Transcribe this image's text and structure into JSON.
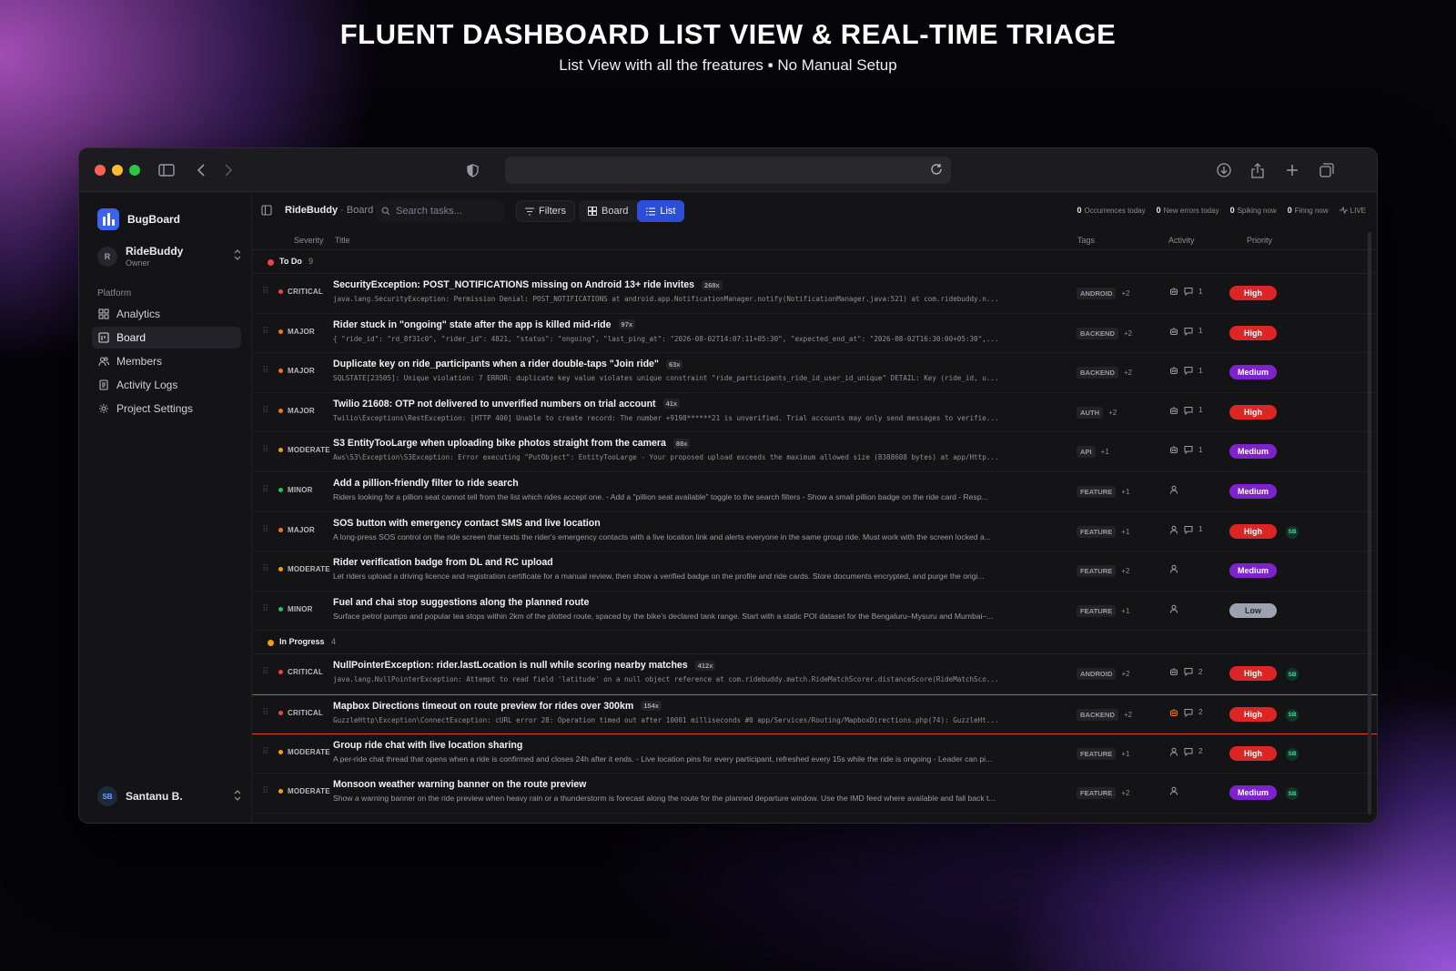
{
  "hero": {
    "title": "FLUENT DASHBOARD LIST VIEW & REAL-TIME TRIAGE",
    "subtitle": "List View with all the freatures ▪ No Manual Setup"
  },
  "colors": {
    "traffic_close": "#fe5f57",
    "traffic_min": "#febc2e",
    "traffic_max": "#28c840",
    "accent": "#2c4ed8",
    "critical": "#ef4444",
    "major": "#f97316",
    "moderate": "#f59e0b",
    "minor": "#22c55e",
    "todo_dot": "#ef4444",
    "inprogress_dot": "#f59e0b",
    "prio_high": "#dc2626",
    "prio_medium": "#7e22ce",
    "prio_low": "#9ca3af"
  },
  "sidebar": {
    "brand": "BugBoard",
    "project_initial": "R",
    "project_name": "RideBuddy",
    "project_role": "Owner",
    "section": "Platform",
    "items": [
      {
        "label": "Analytics",
        "icon": "grid-icon"
      },
      {
        "label": "Board",
        "icon": "board-icon"
      },
      {
        "label": "Members",
        "icon": "users-icon"
      },
      {
        "label": "Activity Logs",
        "icon": "logs-icon"
      },
      {
        "label": "Project Settings",
        "icon": "gear-icon"
      }
    ],
    "user_initials": "SB",
    "user_name": "Santanu B."
  },
  "toolbar": {
    "project": "RideBuddy",
    "page": "· Board",
    "search_placeholder": "Search tasks...",
    "filters": "Filters",
    "view_board": "Board",
    "view_list": "List",
    "stats": [
      {
        "value": "0",
        "label": "Occurrences today"
      },
      {
        "value": "0",
        "label": "New errors today"
      },
      {
        "value": "0",
        "label": "Spiking now"
      },
      {
        "value": "0",
        "label": "Firing now"
      }
    ],
    "live": "LIVE"
  },
  "columns": {
    "severity": "Severity",
    "title": "Title",
    "tags": "Tags",
    "activity": "Activity",
    "priority": "Priority"
  },
  "groups": [
    {
      "name": "To Do",
      "count": "9",
      "rows": [
        {
          "severity": "CRITICAL",
          "sev_color": "#ef4444",
          "title": "SecurityException: POST_NOTIFICATIONS missing on Android 13+ ride invites",
          "count": "268x",
          "desc": "java.lang.SecurityException: Permission Denial: POST_NOTIFICATIONS at android.app.NotificationManager.notify(NotificationManager.java:521) at com.ridebuddy.n...",
          "mono": true,
          "tag": "ANDROID",
          "tag_more": "+2",
          "bot": true,
          "comments": "1",
          "user": false,
          "priority": "High",
          "assignee": ""
        },
        {
          "severity": "MAJOR",
          "sev_color": "#f97316",
          "title": "Rider stuck in \"ongoing\" state after the app is killed mid-ride",
          "count": "97x",
          "desc": "{ \"ride_id\": \"rd_8f31c0\", \"rider_id\": 4821, \"status\": \"ongoing\", \"last_ping_at\": \"2026-08-02T14:07:11+05:30\", \"expected_end_at\": \"2026-08-02T16:30:00+05:30\",...",
          "mono": true,
          "tag": "BACKEND",
          "tag_more": "+2",
          "bot": true,
          "comments": "1",
          "user": false,
          "priority": "High",
          "assignee": ""
        },
        {
          "severity": "MAJOR",
          "sev_color": "#f97316",
          "title": "Duplicate key on ride_participants when a rider double-taps \"Join ride\"",
          "count": "63x",
          "desc": "SQLSTATE[23505]: Unique violation: 7 ERROR: duplicate key value violates unique constraint \"ride_participants_ride_id_user_id_unique\" DETAIL: Key (ride_id, u...",
          "mono": true,
          "tag": "BACKEND",
          "tag_more": "+2",
          "bot": true,
          "comments": "1",
          "user": false,
          "priority": "Medium",
          "assignee": ""
        },
        {
          "severity": "MAJOR",
          "sev_color": "#f97316",
          "title": "Twilio 21608: OTP not delivered to unverified numbers on trial account",
          "count": "41x",
          "desc": "Twilio\\Exceptions\\RestException: [HTTP 400] Unable to create record: The number +9198******21 is unverified. Trial accounts may only send messages to verifie...",
          "mono": true,
          "tag": "AUTH",
          "tag_more": "+2",
          "bot": true,
          "comments": "1",
          "user": false,
          "priority": "High",
          "assignee": ""
        },
        {
          "severity": "MODERATE",
          "sev_color": "#f59e0b",
          "title": "S3 EntityTooLarge when uploading bike photos straight from the camera",
          "count": "88x",
          "desc": "Aws\\S3\\Exception\\S3Exception: Error executing \"PutObject\": EntityTooLarge - Your proposed upload exceeds the maximum allowed size (8388608 bytes) at app/Http...",
          "mono": true,
          "tag": "API",
          "tag_more": "+1",
          "bot": true,
          "comments": "1",
          "user": false,
          "priority": "Medium",
          "assignee": ""
        },
        {
          "severity": "MINOR",
          "sev_color": "#22c55e",
          "title": "Add a pillion-friendly filter to ride search",
          "count": "",
          "desc": "Riders looking for a pillion seat cannot tell from the list which rides accept one. - Add a \"pillion seat available\" toggle to the search filters - Show a small pillion badge on the ride card - Resp...",
          "mono": false,
          "tag": "FEATURE",
          "tag_more": "+1",
          "bot": false,
          "comments": "",
          "user": true,
          "priority": "Medium",
          "assignee": ""
        },
        {
          "severity": "MAJOR",
          "sev_color": "#f97316",
          "title": "SOS button with emergency contact SMS and live location",
          "count": "",
          "desc": "A long-press SOS control on the ride screen that texts the rider's emergency contacts with a live location link and alerts everyone in the same group ride. Must work with the screen locked a...",
          "mono": false,
          "tag": "FEATURE",
          "tag_more": "+1",
          "bot": false,
          "comments": "1",
          "user": true,
          "priority": "High",
          "assignee": "SB"
        },
        {
          "severity": "MODERATE",
          "sev_color": "#f59e0b",
          "title": "Rider verification badge from DL and RC upload",
          "count": "",
          "desc": "Let riders upload a driving licence and registration certificate for a manual review, then show a verified badge on the profile and ride cards. Store documents encrypted, and purge the origi...",
          "mono": false,
          "tag": "FEATURE",
          "tag_more": "+2",
          "bot": false,
          "comments": "",
          "user": true,
          "priority": "Medium",
          "assignee": ""
        },
        {
          "severity": "MINOR",
          "sev_color": "#22c55e",
          "title": "Fuel and chai stop suggestions along the planned route",
          "count": "",
          "desc": "Surface petrol pumps and popular tea stops within 2km of the plotted route, spaced by the bike's declared tank range. Start with a static POI dataset for the Bengaluru–Mysuru and Mumbai–...",
          "mono": false,
          "tag": "FEATURE",
          "tag_more": "+1",
          "bot": false,
          "comments": "",
          "user": true,
          "priority": "Low",
          "assignee": ""
        }
      ]
    },
    {
      "name": "In Progress",
      "count": "4",
      "rows": [
        {
          "severity": "CRITICAL",
          "sev_color": "#ef4444",
          "title": "NullPointerException: rider.lastLocation is null while scoring nearby matches",
          "count": "412x",
          "desc": "java.lang.NullPointerException: Attempt to read field 'latitude' on a null object reference at com.ridebuddy.match.RideMatchScorer.distanceScore(RideMatchSco...",
          "mono": true,
          "tag": "ANDROID",
          "tag_more": "+2",
          "bot": true,
          "comments": "2",
          "user": false,
          "priority": "High",
          "assignee": "SB",
          "highlight": false
        },
        {
          "severity": "CRITICAL",
          "sev_color": "#ef4444",
          "title": "Mapbox Directions timeout on route preview for rides over 300km",
          "count": "154x",
          "desc": "GuzzleHttp\\Exception\\ConnectException: cURL error 28: Operation timed out after 10001 milliseconds #0 app/Services/Routing/MapboxDirections.php(74): GuzzleHt...",
          "mono": true,
          "tag": "BACKEND",
          "tag_more": "+2",
          "bot": true,
          "bot_alert": true,
          "comments": "2",
          "user": false,
          "priority": "High",
          "assignee": "SB",
          "highlight": true
        },
        {
          "severity": "MODERATE",
          "sev_color": "#f59e0b",
          "title": "Group ride chat with live location sharing",
          "count": "",
          "desc": "A per-ride chat thread that opens when a ride is confirmed and closes 24h after it ends. - Live location pins for every participant, refreshed every 15s while the ride is ongoing - Leader can pi...",
          "mono": false,
          "tag": "FEATURE",
          "tag_more": "+1",
          "bot": false,
          "comments": "2",
          "user": true,
          "priority": "High",
          "assignee": "SB"
        },
        {
          "severity": "MODERATE",
          "sev_color": "#f59e0b",
          "title": "Monsoon weather warning banner on the route preview",
          "count": "",
          "desc": "Show a warning banner on the ride preview when heavy rain or a thunderstorm is forecast along the route for the planned departure window. Use the IMD feed where available and fall back t...",
          "mono": false,
          "tag": "FEATURE",
          "tag_more": "+2",
          "bot": false,
          "comments": "",
          "user": true,
          "priority": "Medium",
          "assignee": "SB"
        }
      ]
    }
  ]
}
